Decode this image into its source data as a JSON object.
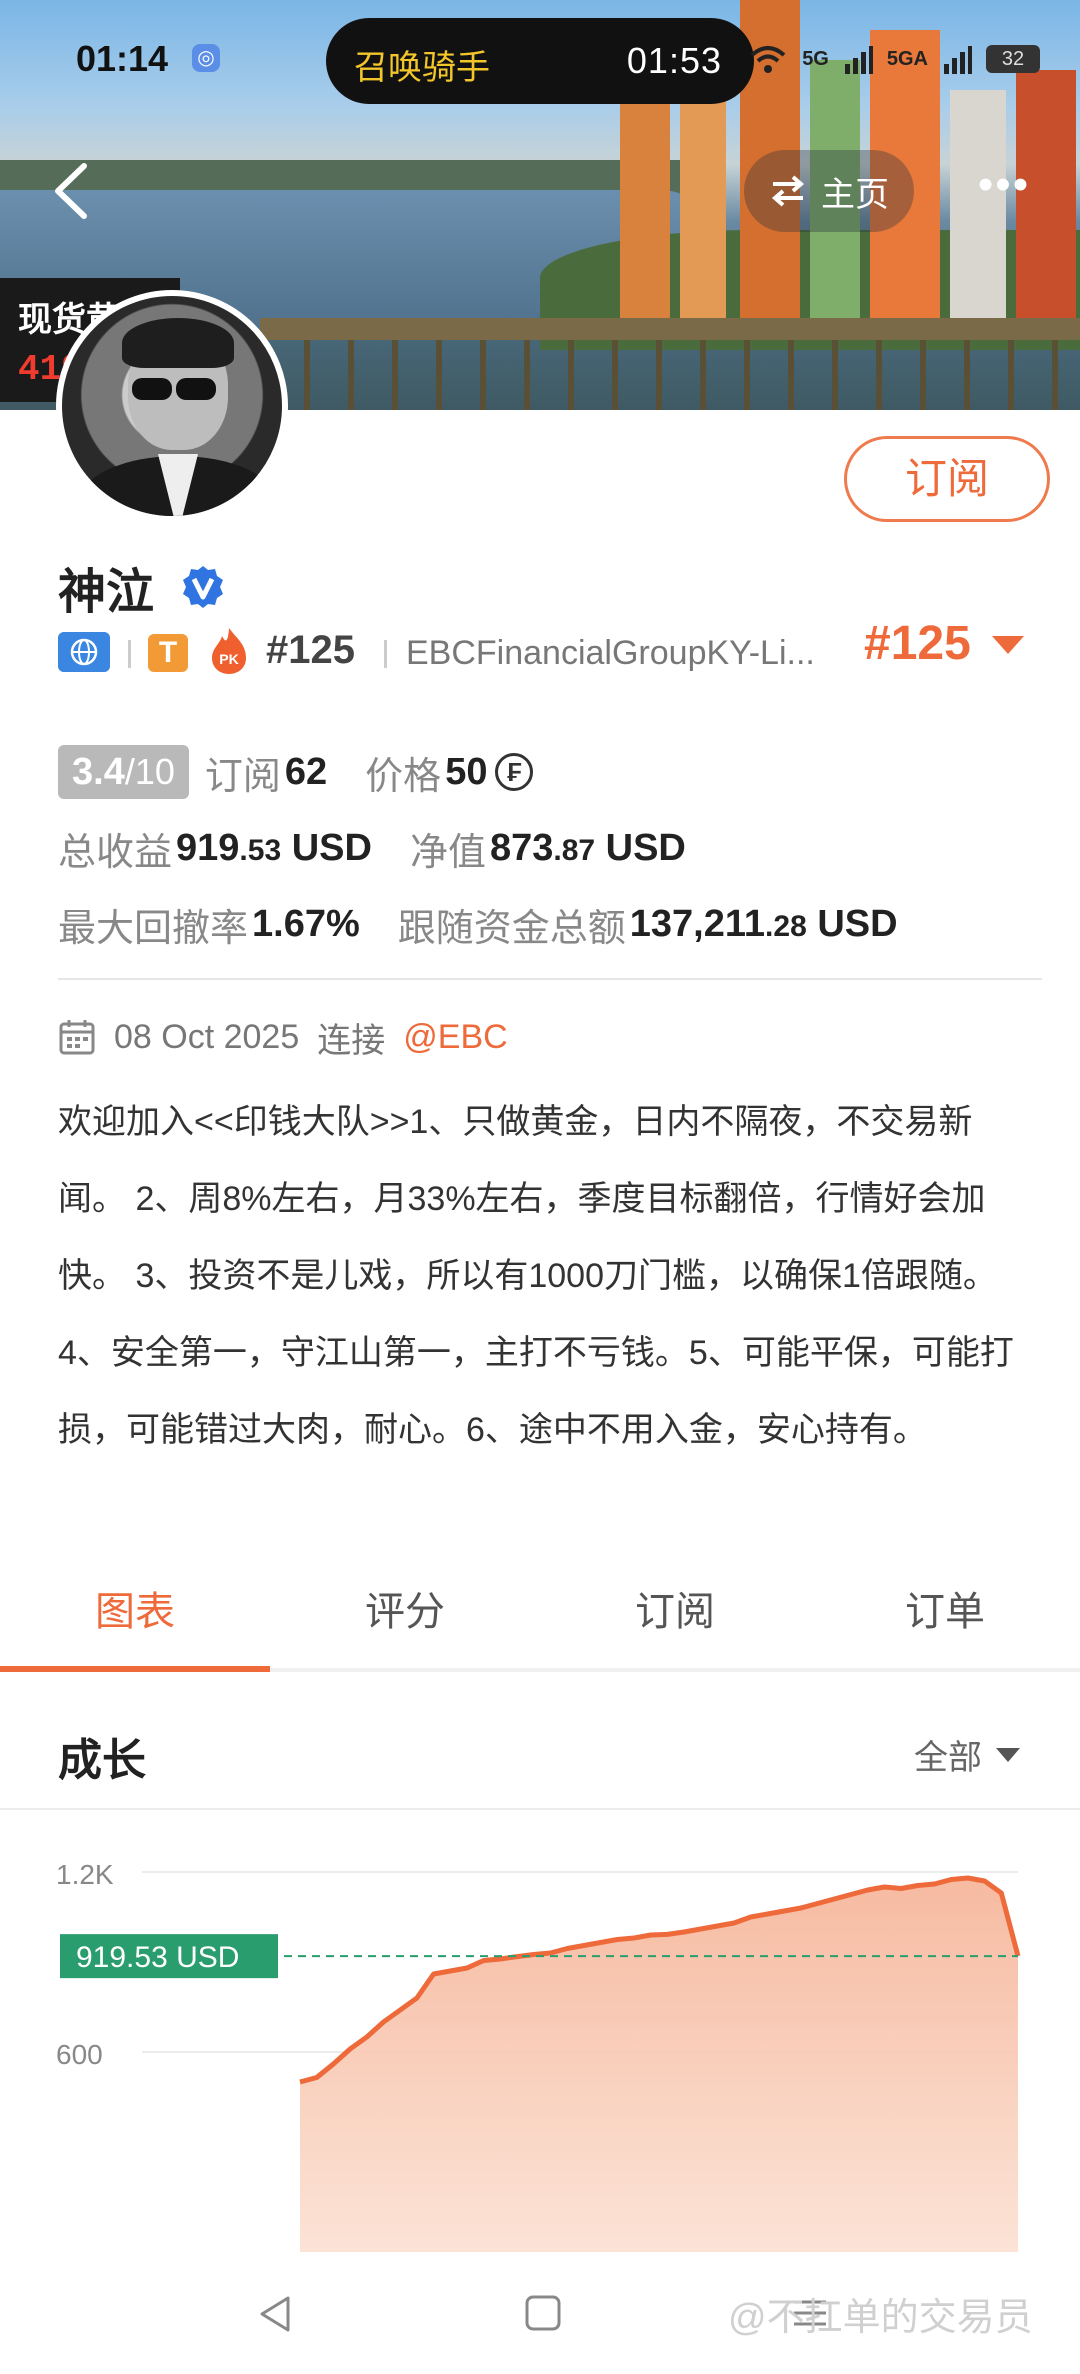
{
  "status_bar": {
    "time": "01:14",
    "call_label": "召唤骑手",
    "call_timer": "01:53",
    "network_1": "5G",
    "network_2": "5GA",
    "battery": "32"
  },
  "header": {
    "home_label": "主页"
  },
  "gold_ticker": {
    "label": "现货黄金",
    "value": "4198.81"
  },
  "profile": {
    "name": "神泣",
    "subscribe_label": "订阅",
    "t_badge": "T",
    "rank_small": "#125",
    "broker": "EBCFinancialGroupKY-Li...",
    "rank_big": "#125"
  },
  "stats": {
    "score": "3.4",
    "score_max": "/10",
    "subscribe_label": "订阅",
    "subscribe_count": "62",
    "price_label": "价格",
    "price_value": "50",
    "total_profit_label": "总收益",
    "total_profit_int": "919",
    "total_profit_dec": ".53",
    "net_value_label": "净值",
    "net_value_int": "873",
    "net_value_dec": ".87",
    "currency": "USD",
    "drawdown_label": "最大回撤率",
    "drawdown_value": "1.67%",
    "follow_funds_label": "跟随资金总额",
    "follow_funds_int": "137,211",
    "follow_funds_dec": ".28"
  },
  "connect": {
    "date": "08 Oct 2025",
    "label": "连接",
    "broker_tag": "@EBC"
  },
  "intro": "欢迎加入<<印钱大队>>1、只做黄金，日内不隔夜，不交易新闻。 2、周8%左右，月33%左右，季度目标翻倍，行情好会加快。 3、投资不是儿戏，所以有1000刀门槛，以确保1倍跟随。 4、安全第一，守江山第一，主打不亏钱。5、可能平保，可能打损，可能错过大肉，耐心。6、途中不用入金，安心持有。",
  "tabs": [
    "图表",
    "评分",
    "订阅",
    "订单"
  ],
  "growth": {
    "title": "成长",
    "range": "全部"
  },
  "colors": {
    "accent": "#ee6a3a",
    "area_fill": "#f6b79c",
    "marker": "#2a9d6e",
    "gold_price": "#f03c2e"
  },
  "chart_data": {
    "type": "area",
    "y_ticks": [
      "1.2K",
      "600"
    ],
    "ylim": [
      500,
      1300
    ],
    "marker_label": "919.53 USD",
    "marker_value": 919.53,
    "series": [
      {
        "values": [
          500,
          515,
          560,
          610,
          650,
          700,
          740,
          780,
          860,
          870,
          880,
          905,
          910,
          918,
          925,
          930,
          945,
          955,
          965,
          975,
          980,
          990,
          992,
          1000,
          1010,
          1020,
          1030,
          1050,
          1060,
          1070,
          1080,
          1095,
          1110,
          1125,
          1140,
          1150,
          1145,
          1155,
          1160,
          1175,
          1180,
          1170,
          1130,
          920
        ]
      }
    ]
  },
  "system_nav": {
    "back_icon": "back-triangle-icon",
    "home_icon": "home-square-icon"
  },
  "watermark": "@不扛单的交易员"
}
